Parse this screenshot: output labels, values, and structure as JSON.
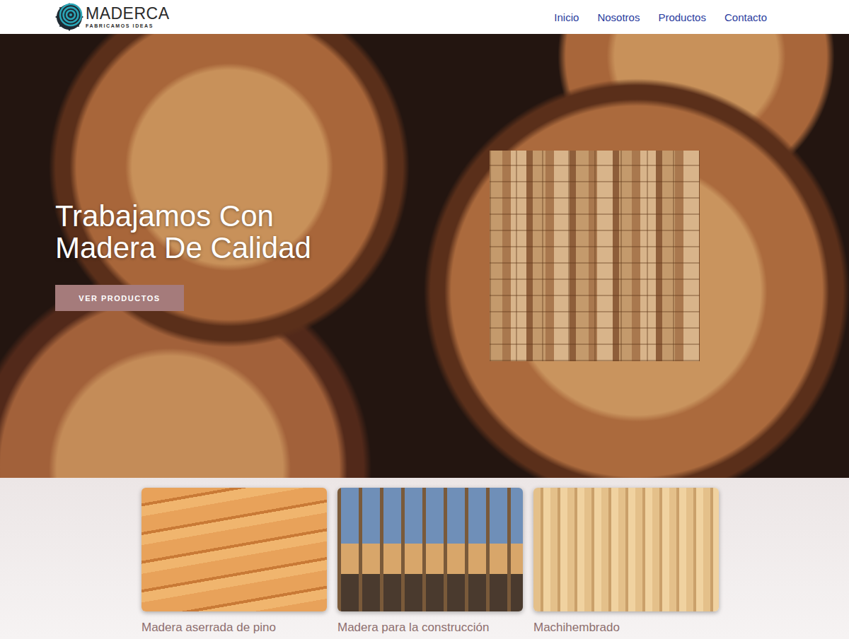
{
  "header": {
    "logo": {
      "name": "MADERCA",
      "tagline": "FABRICAMOS IDEAS"
    },
    "nav": [
      {
        "label": "Inicio"
      },
      {
        "label": "Nosotros"
      },
      {
        "label": "Productos"
      },
      {
        "label": "Contacto"
      }
    ]
  },
  "hero": {
    "title_lines": [
      "Trabajamos Con",
      "Madera De Calidad"
    ],
    "button": "VER PRODUCTOS"
  },
  "products": [
    {
      "label": "Madera aserrada de pino"
    },
    {
      "label": "Madera para la construcción"
    },
    {
      "label": "Machihembrado"
    }
  ]
}
